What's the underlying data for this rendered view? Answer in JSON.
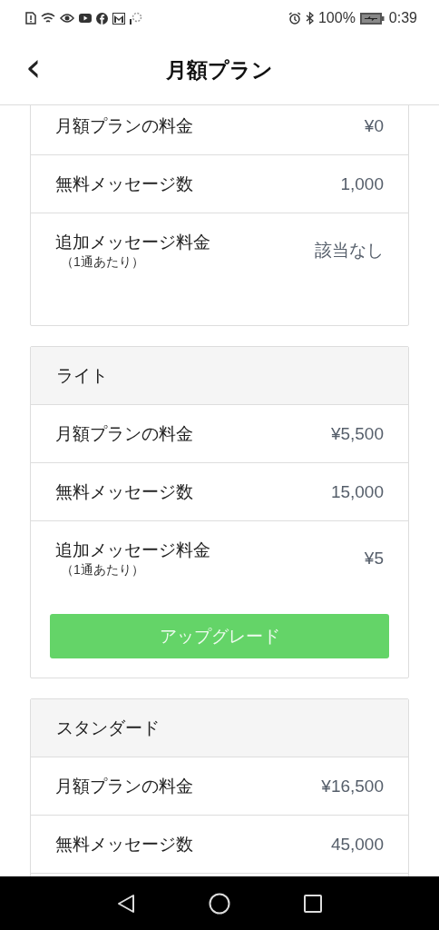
{
  "status_bar": {
    "battery": "100%",
    "time": "0:39"
  },
  "header": {
    "back": "‹",
    "title": "月額プラン"
  },
  "plans": [
    {
      "rows": [
        {
          "label": "月額プランの料金",
          "value": "¥0"
        },
        {
          "label": "無料メッセージ数",
          "value": "1,000"
        },
        {
          "label": "追加メッセージ料金",
          "note": "（1通あたり）",
          "value": "該当なし"
        }
      ]
    },
    {
      "name": "ライト",
      "rows": [
        {
          "label": "月額プランの料金",
          "value": "¥5,500"
        },
        {
          "label": "無料メッセージ数",
          "value": "15,000"
        },
        {
          "label": "追加メッセージ料金",
          "note": "（1通あたり）",
          "value": "¥5"
        }
      ],
      "button": "アップグレード"
    },
    {
      "name": "スタンダード",
      "rows": [
        {
          "label": "月額プランの料金",
          "value": "¥16,500"
        },
        {
          "label": "無料メッセージ数",
          "value": "45,000"
        }
      ]
    }
  ]
}
